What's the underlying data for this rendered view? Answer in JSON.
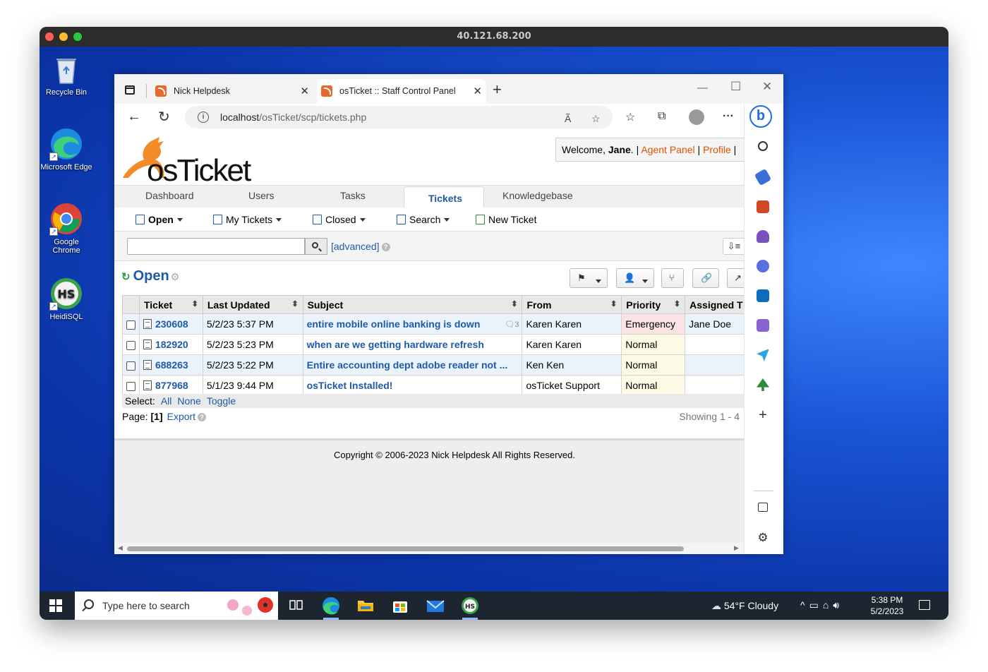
{
  "mac": {
    "title": "40.121.68.200"
  },
  "desktop": {
    "icons": [
      {
        "label": "Recycle Bin"
      },
      {
        "label": "Microsoft Edge"
      },
      {
        "label": "Google Chrome"
      },
      {
        "label": "HeidiSQL"
      }
    ]
  },
  "taskbar": {
    "search_placeholder": "Type here to search",
    "weather": "54°F  Cloudy",
    "time": "5:38 PM",
    "date": "5/2/2023"
  },
  "browser": {
    "tabs": [
      {
        "title": "Nick Helpdesk"
      },
      {
        "title": "osTicket :: Staff Control Panel"
      }
    ],
    "url_host": "localhost",
    "url_path": "/osTicket/scp/tickets.php"
  },
  "osticket": {
    "welcome_prefix": "Welcome, ",
    "user": "Jane",
    "welcome_sep": ". | ",
    "agent_panel": "Agent Panel",
    "sep2": " | ",
    "profile": "Profile",
    "sep3": " |",
    "nav": [
      "Dashboard",
      "Users",
      "Tasks",
      "Tickets",
      "Knowledgebase"
    ],
    "subnav": {
      "open": "Open",
      "my_tickets": "My Tickets",
      "closed": "Closed",
      "search": "Search",
      "new_ticket": "New Ticket"
    },
    "advanced": "[advanced]",
    "queue_title": "Open",
    "columns": [
      "Ticket",
      "Last Updated",
      "Subject",
      "From",
      "Priority",
      "Assigned T"
    ],
    "rows": [
      {
        "number": "230608",
        "updated": "5/2/23 5:37 PM",
        "subject": "entire mobile online banking is down",
        "thread_count": "3",
        "from": "Karen Karen",
        "priority": "Emergency",
        "assigned": "Jane Doe"
      },
      {
        "number": "182920",
        "updated": "5/2/23 5:23 PM",
        "subject": "when are we getting hardware refresh",
        "thread_count": "",
        "from": "Karen Karen",
        "priority": "Normal",
        "assigned": ""
      },
      {
        "number": "688263",
        "updated": "5/2/23 5:22 PM",
        "subject": "Entire accounting dept adobe reader not ...",
        "thread_count": "",
        "from": "Ken Ken",
        "priority": "Normal",
        "assigned": ""
      },
      {
        "number": "877968",
        "updated": "5/1/23 9:44 PM",
        "subject": "osTicket Installed!",
        "thread_count": "",
        "from": "osTicket Support",
        "priority": "Normal",
        "assigned": ""
      }
    ],
    "select_label": "Select:",
    "select_all": "All",
    "select_none": "None",
    "select_toggle": "Toggle",
    "page_label": "Page:",
    "page_current": "[1]",
    "export": "Export",
    "showing": "Showing 1 - 4",
    "copyright": "Copyright © 2006-2023 Nick Helpdesk All Rights Reserved."
  },
  "colors": {
    "brand_orange": "#e65100",
    "link_blue": "#1f5aa8",
    "emergency_bg": "#fbe3e3"
  }
}
